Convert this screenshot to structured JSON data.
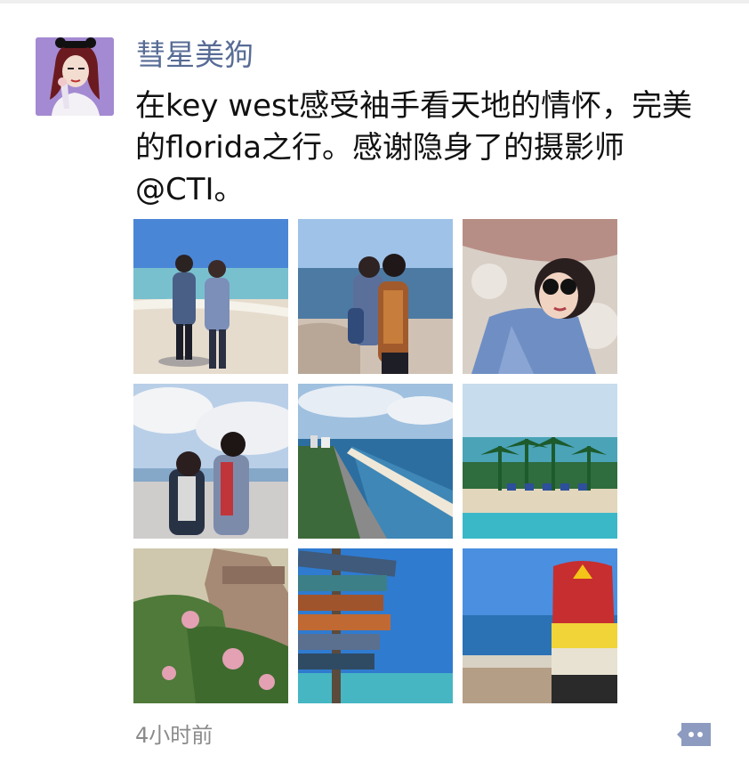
{
  "post": {
    "author": "彗星美狗",
    "text": "在key west感受袖手看天地的情怀，完美\n的florida之行。感谢隐身了的摄影师\n@CTI。",
    "timestamp": "4小时前"
  },
  "photos": [
    {
      "name": "beach-two-women"
    },
    {
      "name": "rocks-ocean-hug"
    },
    {
      "name": "rock-selfie"
    },
    {
      "name": "beach-clouds-pair"
    },
    {
      "name": "coastline-aerial"
    },
    {
      "name": "pool-palms"
    },
    {
      "name": "garden-flowers"
    },
    {
      "name": "signpost-key-west"
    },
    {
      "name": "southernmost-point-buoy"
    }
  ],
  "icons": {
    "comment": "comment-bubble-icon"
  },
  "colors": {
    "author": "#576b95",
    "text": "#111111",
    "timestamp": "#8a8a8a",
    "comment_icon": "#8c9bbf"
  }
}
